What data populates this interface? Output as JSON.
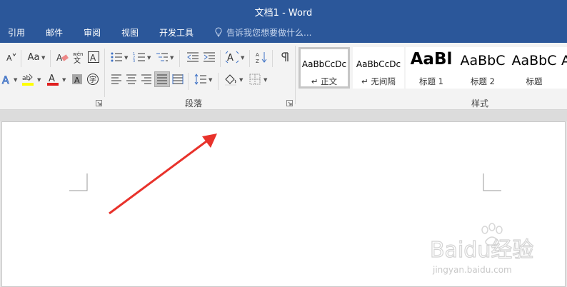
{
  "window": {
    "title": "文档1 - Word",
    "accent": "#2b579a"
  },
  "tabs": [
    {
      "label": "引用"
    },
    {
      "label": "邮件"
    },
    {
      "label": "审阅"
    },
    {
      "label": "视图"
    },
    {
      "label": "开发工具"
    }
  ],
  "tellme": {
    "text": "告诉我您想要做什么...",
    "icon": "lightbulb-icon"
  },
  "font_group": {
    "change_case_label": "Aa",
    "text_highlight_color": "#ffff00",
    "font_color": "#e02020"
  },
  "paragraph_group": {
    "label": "段落",
    "justify_selected": true
  },
  "styles_group": {
    "label": "样式",
    "items": [
      {
        "sample": "AaBbCcDc",
        "name": "正文",
        "selected": true
      },
      {
        "sample": "AaBbCcDc",
        "name": "无间隔"
      },
      {
        "sample": "AaBl",
        "name": "标题 1"
      },
      {
        "sample": "AaBbC",
        "name": "标题 2"
      },
      {
        "sample": "AaBbC",
        "name": "标题"
      },
      {
        "sample": "A",
        "name": ""
      }
    ]
  },
  "annotation": {
    "color": "#e8322b"
  },
  "watermark": {
    "brand": "Baidu经验",
    "url": "jingyan.baidu.com"
  }
}
